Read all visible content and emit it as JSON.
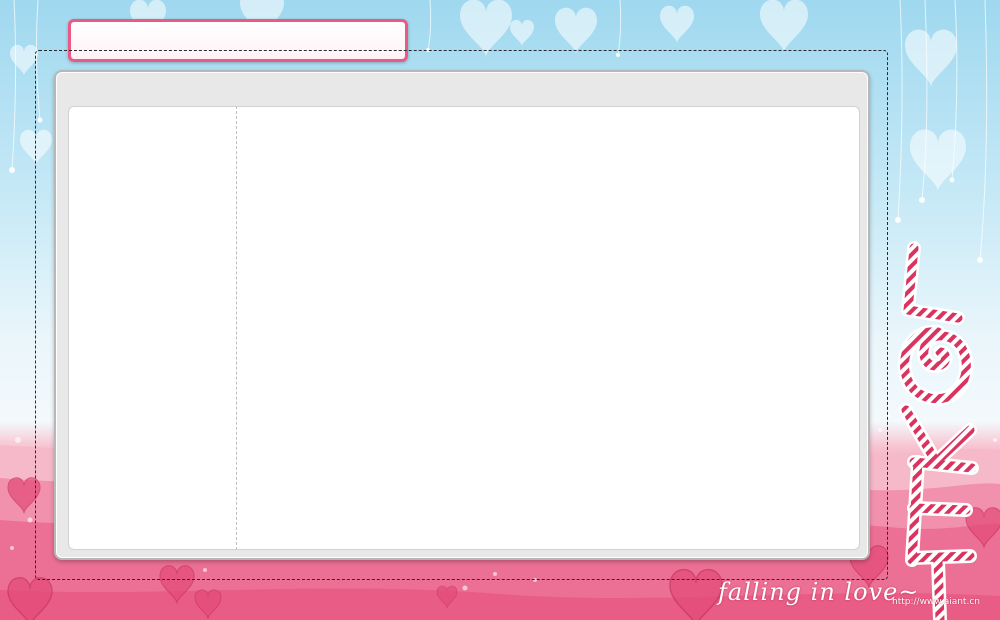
{
  "window": {
    "title_value": ""
  },
  "decoration": {
    "love_letters": [
      "L",
      "O",
      "V",
      "E"
    ],
    "tagline": "falling in love~",
    "site_url": "http://www.aiant.cn"
  },
  "colors": {
    "sky": "#9fd8ef",
    "pink": "#ee6f93",
    "accent": "#e95b84",
    "panel": "#e8e8e8"
  }
}
